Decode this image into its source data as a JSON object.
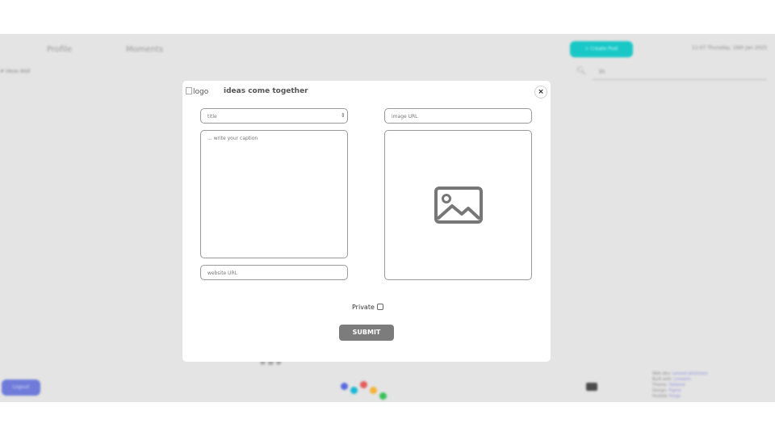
{
  "background": {
    "nav": {
      "profile": "Profile",
      "moments": "Moments"
    },
    "create_post": "+ Create Post",
    "date_text": "11:07 Thursday, 16th Jan 2025",
    "search_value": "in",
    "left_text": "# Ideas Wall",
    "logout": "Logout",
    "info_lines": [
      {
        "label": "Web dev",
        "link": "Laravel Jetstream"
      },
      {
        "label": "Built with",
        "link": "Livewire"
      },
      {
        "label": "Theme",
        "link": "Tailwind"
      },
      {
        "label": "Design",
        "link": "Figma"
      },
      {
        "label": "Hosted",
        "link": "Forge"
      }
    ],
    "dot_colors": [
      "#5a6be0",
      "#1bb8d6",
      "#e45c5c",
      "#f4b23a",
      "#3ac25a"
    ]
  },
  "modal": {
    "logo_alt": "logo",
    "tagline": "ideas come together",
    "close_icon": "×",
    "title_placeholder": "title",
    "stepper_icon": "⇕",
    "image_url_placeholder": "image URL",
    "caption_placeholder": "... write your caption",
    "website_placeholder": "website URL",
    "private_label": "Private",
    "submit_label": "SUBMIT",
    "image_placeholder_icon": "image-icon"
  }
}
